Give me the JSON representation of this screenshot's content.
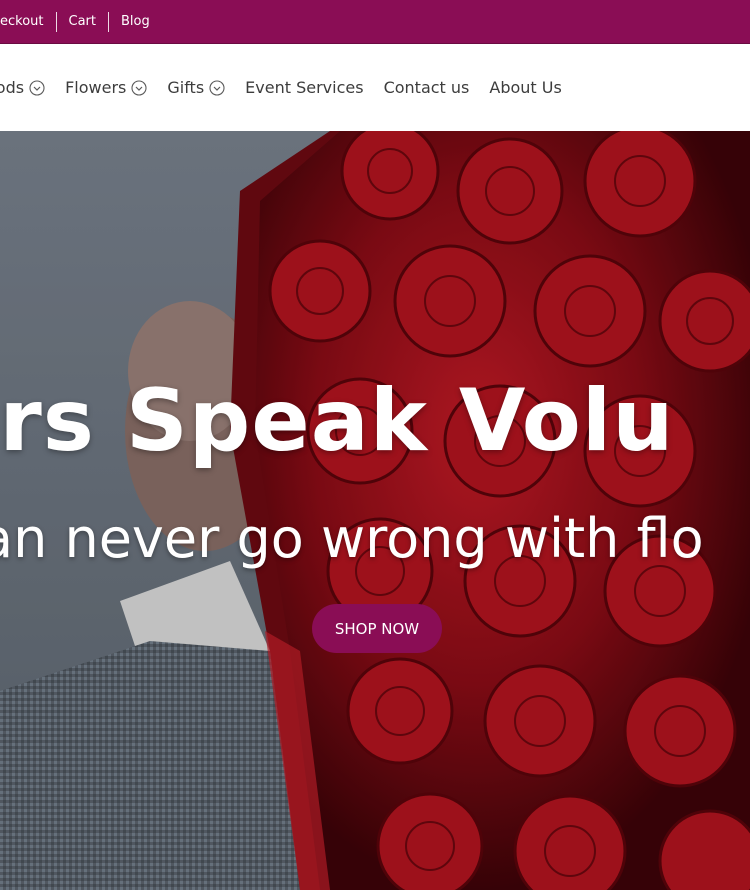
{
  "topbar": {
    "links": [
      "eckout",
      "Cart",
      "Blog"
    ]
  },
  "nav": {
    "items": [
      {
        "label": "oods",
        "dropdown": true
      },
      {
        "label": "Flowers",
        "dropdown": true
      },
      {
        "label": "Gifts",
        "dropdown": true
      },
      {
        "label": "Event Services",
        "dropdown": false
      },
      {
        "label": "Contact us",
        "dropdown": false
      },
      {
        "label": "About Us",
        "dropdown": false
      }
    ]
  },
  "hero": {
    "title": "ers Speak Volu",
    "subtitle": "an never go wrong with flo",
    "cta_label": "SHOP NOW"
  },
  "colors": {
    "brand": "#8a0d55",
    "nav_text": "#3d3d3d",
    "rose_red": "#8b0c16"
  }
}
